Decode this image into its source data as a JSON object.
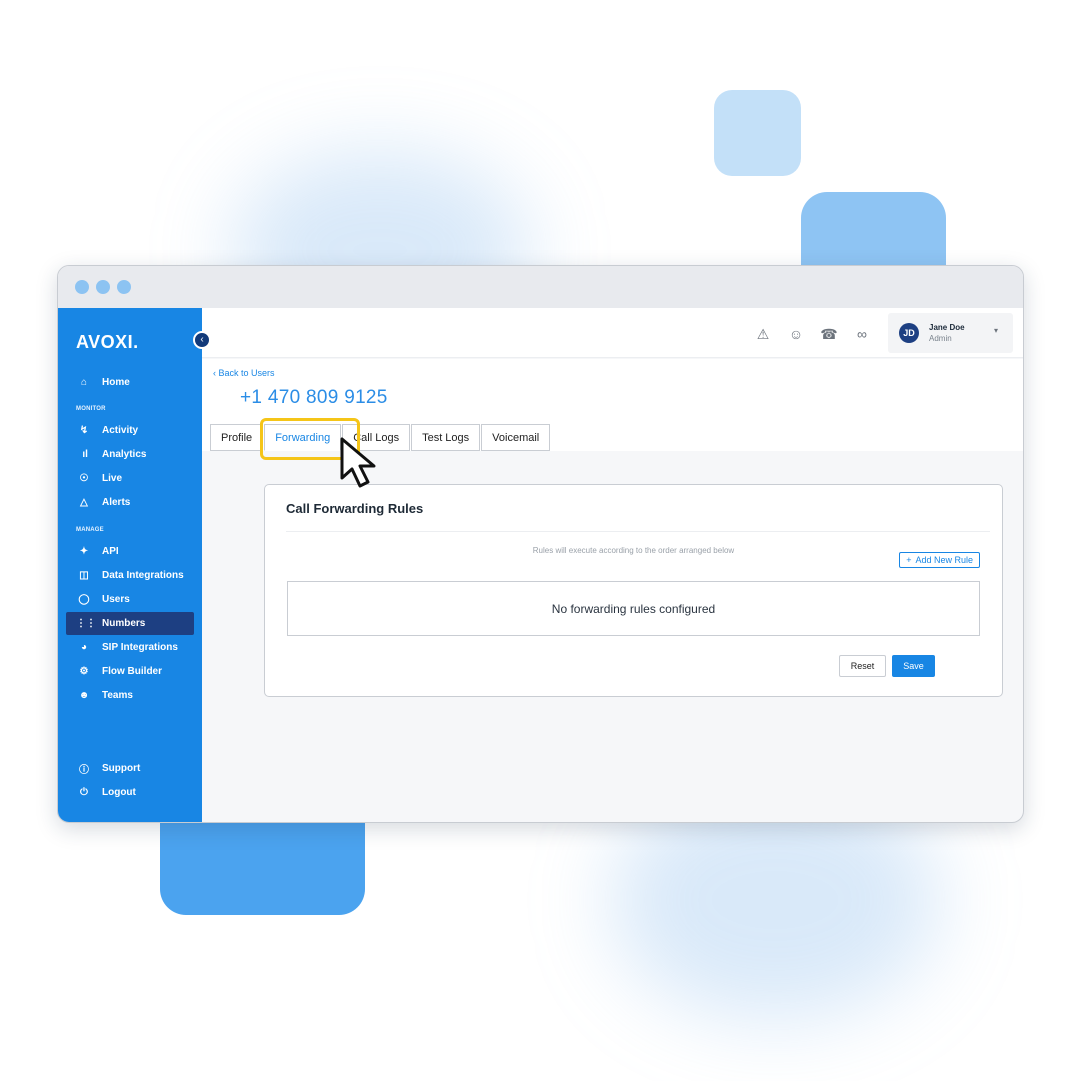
{
  "window": {
    "controls": [
      "close",
      "minimize",
      "maximize"
    ]
  },
  "sidebar": {
    "logo": "AVOXI.",
    "collapse_icon": "chevron-left-icon",
    "home": {
      "label": "Home",
      "icon": "home-icon"
    },
    "monitor_label": "MONITOR",
    "monitor_items": [
      {
        "label": "Activity",
        "icon": "bolt-icon"
      },
      {
        "label": "Analytics",
        "icon": "bar-chart-icon"
      },
      {
        "label": "Live",
        "icon": "live-icon"
      },
      {
        "label": "Alerts",
        "icon": "alert-icon"
      }
    ],
    "manage_label": "MANAGE",
    "manage_items": [
      {
        "label": "API",
        "icon": "plug-icon"
      },
      {
        "label": "Data Integrations",
        "icon": "database-icon"
      },
      {
        "label": "Users",
        "icon": "user-icon"
      },
      {
        "label": "Numbers",
        "icon": "dialpad-icon",
        "active": true
      },
      {
        "label": "SIP Integrations",
        "icon": "sip-icon"
      },
      {
        "label": "Flow Builder",
        "icon": "flow-icon"
      },
      {
        "label": "Teams",
        "icon": "teams-icon"
      }
    ],
    "footer_items": [
      {
        "label": "Support",
        "icon": "help-icon"
      },
      {
        "label": "Logout",
        "icon": "power-icon"
      }
    ]
  },
  "header": {
    "icons": [
      "warning-icon",
      "user-circle-icon",
      "phone-icon",
      "voicemail-icon"
    ],
    "user": {
      "initials": "JD",
      "name": "Jane Doe",
      "role": "Admin"
    }
  },
  "page": {
    "back_link": "Back to Users",
    "phone_number": "+1 470 809 9125",
    "tabs": [
      {
        "label": "Profile"
      },
      {
        "label": "Forwarding",
        "active": true
      },
      {
        "label": "Call Logs"
      },
      {
        "label": "Test Logs"
      },
      {
        "label": "Voicemail"
      }
    ]
  },
  "card": {
    "title": "Call Forwarding Rules",
    "hint": "Rules will execute according to the order arranged below",
    "add_rule": "Add New Rule",
    "empty_message": "No forwarding rules configured",
    "reset": "Reset",
    "save": "Save"
  },
  "colors": {
    "sidebar": "#1886e4",
    "active_nav": "#1d3f82",
    "accent": "#1886e4",
    "highlight": "#f5c518"
  }
}
